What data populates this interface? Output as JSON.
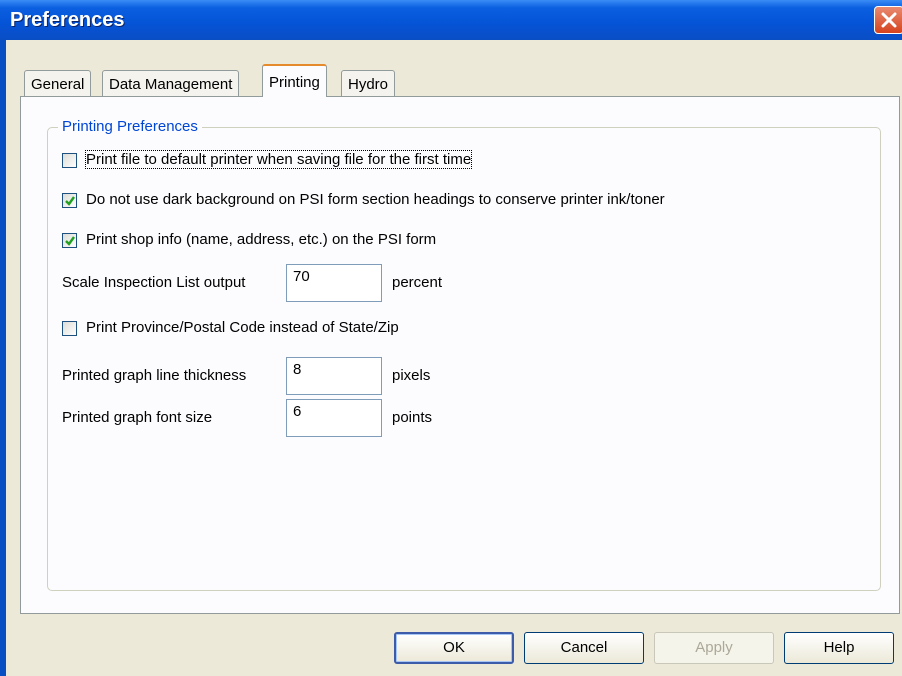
{
  "window": {
    "title": "Preferences"
  },
  "tabs": [
    {
      "label": "General"
    },
    {
      "label": "Data Management"
    },
    {
      "label": "Printing",
      "active": true
    },
    {
      "label": "Hydro"
    }
  ],
  "group": {
    "title": "Printing Preferences"
  },
  "options": {
    "print_default": {
      "label": "Print file to default printer when saving file for the first time",
      "checked": false
    },
    "no_dark_bg": {
      "label": "Do not use dark background on PSI form section headings to conserve printer ink/toner",
      "checked": true
    },
    "shop_info": {
      "label": "Print shop info (name, address, etc.) on the PSI form",
      "checked": true
    },
    "province": {
      "label": "Print Province/Postal Code instead of State/Zip",
      "checked": false
    }
  },
  "fields": {
    "scale": {
      "label": "Scale Inspection List output",
      "value": "70",
      "unit": "percent"
    },
    "line_thickness": {
      "label": "Printed graph line thickness",
      "value": "8",
      "unit": "pixels"
    },
    "font_size": {
      "label": "Printed graph font size",
      "value": "6",
      "unit": "points"
    }
  },
  "buttons": {
    "ok": "OK",
    "cancel": "Cancel",
    "apply": "Apply",
    "help": "Help"
  },
  "colors": {
    "title_bar": "#0553d6",
    "group_title": "#0046d5",
    "dialog_bg": "#ece9d8",
    "active_tab_accent": "#e68b2c"
  }
}
